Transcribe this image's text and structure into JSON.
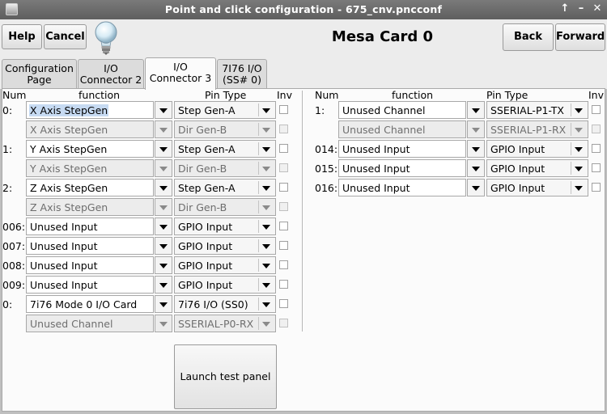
{
  "window": {
    "title": "Point and click configuration - 675_cnv.pncconf"
  },
  "window_controls": {
    "up": "↑",
    "minimize": "–",
    "close": "✕"
  },
  "toolbar": {
    "help": "Help",
    "cancel": "Cancel",
    "card_title": "Mesa Card 0",
    "back": "Back",
    "forward": "Forward"
  },
  "tabs": [
    {
      "line1": "Configuration",
      "line2": "Page"
    },
    {
      "line1": "I/O",
      "line2": "Connector 2"
    },
    {
      "line1": "I/O",
      "line2": "Connector 3"
    },
    {
      "line1": "7I76 I/O",
      "line2": "(SS# 0)"
    }
  ],
  "headers": {
    "num": "Num",
    "function": "function",
    "pin_type": "Pin Type",
    "inv": "Inv"
  },
  "left_rows": [
    {
      "num": "0:",
      "function": "X Axis StepGen",
      "pin": "Step Gen-A",
      "enabled": true,
      "selected": true
    },
    {
      "num": "",
      "function": "X Axis StepGen",
      "pin": "Dir Gen-B",
      "enabled": false
    },
    {
      "num": "1:",
      "function": "Y Axis StepGen",
      "pin": "Step Gen-A",
      "enabled": true
    },
    {
      "num": "",
      "function": "Y Axis StepGen",
      "pin": "Dir Gen-B",
      "enabled": false
    },
    {
      "num": "2:",
      "function": "Z Axis StepGen",
      "pin": "Step Gen-A",
      "enabled": true
    },
    {
      "num": "",
      "function": "Z Axis StepGen",
      "pin": "Dir Gen-B",
      "enabled": false
    },
    {
      "num": "006:",
      "function": "Unused Input",
      "pin": "GPIO Input",
      "enabled": true
    },
    {
      "num": "007:",
      "function": "Unused Input",
      "pin": "GPIO Input",
      "enabled": true
    },
    {
      "num": "008:",
      "function": "Unused Input",
      "pin": "GPIO Input",
      "enabled": true
    },
    {
      "num": "009:",
      "function": "Unused Input",
      "pin": "GPIO Input",
      "enabled": true
    },
    {
      "num": "0:",
      "function": "7i76 Mode 0 I/O Card",
      "pin": "7i76 I/O (SS0)",
      "enabled": true
    },
    {
      "num": "",
      "function": "Unused Channel",
      "pin": "SSERIAL-P0-RX",
      "enabled": false
    }
  ],
  "right_rows": [
    {
      "num": "1:",
      "function": "Unused Channel",
      "pin": "SSERIAL-P1-TX",
      "enabled": true
    },
    {
      "num": "",
      "function": "Unused Channel",
      "pin": "SSERIAL-P1-RX",
      "enabled": false
    },
    {
      "num": "014:",
      "function": "Unused Input",
      "pin": "GPIO Input",
      "enabled": true
    },
    {
      "num": "015:",
      "function": "Unused Input",
      "pin": "GPIO Input",
      "enabled": true
    },
    {
      "num": "016:",
      "function": "Unused Input",
      "pin": "GPIO Input",
      "enabled": true
    }
  ],
  "launch_test_panel": "Launch test panel"
}
